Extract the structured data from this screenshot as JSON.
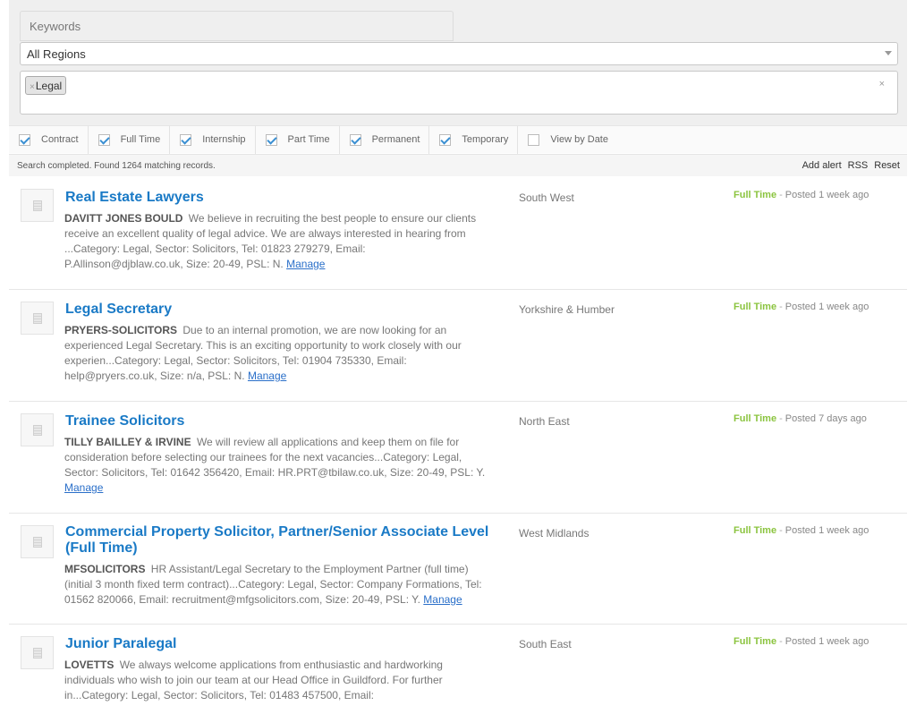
{
  "filters": {
    "keywords_placeholder": "Keywords",
    "region_selected": "All Regions",
    "tags": [
      {
        "remove_glyph": "×",
        "label": "Legal"
      }
    ],
    "clear_glyph": "×"
  },
  "job_types": [
    {
      "label": "Contract",
      "checked": true
    },
    {
      "label": "Full Time",
      "checked": true
    },
    {
      "label": "Internship",
      "checked": true
    },
    {
      "label": "Part Time",
      "checked": true
    },
    {
      "label": "Permanent",
      "checked": true
    },
    {
      "label": "Temporary",
      "checked": true
    },
    {
      "label": "View by Date",
      "checked": false
    }
  ],
  "status": {
    "message": "Search completed. Found 1264 matching records.",
    "actions": [
      "Add alert",
      "RSS",
      "Reset"
    ]
  },
  "jobs": [
    {
      "title_lines": [
        "Real Estate Lawyers"
      ],
      "company": "DAVITT JONES BOULD",
      "desc_lines": [
        "We believe in recruiting the best people to ensure our clients",
        "receive an excellent quality of legal advice. We are always interested in hearing from",
        "...Category: Legal, Sector: Solicitors, Tel: 01823 279279, Email:",
        "P.Allinson@djblaw.co.uk, Size: 20-49, PSL: N."
      ],
      "manage": "Manage",
      "location": "South West",
      "job_type": "Full Time",
      "separator": "-",
      "posted": "Posted 1 week ago"
    },
    {
      "title_lines": [
        "Legal Secretary"
      ],
      "company": "PRYERS-SOLICITORS",
      "desc_lines": [
        "Due to an internal promotion, we are now looking for an",
        "experienced Legal Secretary. This is an exciting opportunity to work closely with our",
        "experien...Category: Legal, Sector: Solicitors, Tel: 01904 735330, Email:",
        "help@pryers.co.uk, Size: n/a, PSL: N."
      ],
      "manage": "Manage",
      "location": "Yorkshire & Humber",
      "job_type": "Full Time",
      "separator": "-",
      "posted": "Posted 1 week ago"
    },
    {
      "title_lines": [
        "Trainee Solicitors"
      ],
      "company": "TILLY BAILLEY & IRVINE",
      "desc_lines": [
        "We will review all applications and keep them on file for",
        "consideration before selecting our trainees for the next vacancies...Category: Legal,",
        "Sector: Solicitors, Tel: 01642 356420, Email: HR.PRT@tbilaw.co.uk, Size: 20-49, PSL: Y.",
        ""
      ],
      "manage": "Manage",
      "location": "North East",
      "job_type": "Full Time",
      "separator": "-",
      "posted": "Posted 7 days ago"
    },
    {
      "title_lines": [
        "Commercial Property Solicitor, Partner/Senior Associate Level",
        "(Full Time)"
      ],
      "company": "MFSOLICITORS",
      "desc_lines": [
        "HR Assistant/Legal Secretary to the Employment Partner (full time)",
        "(initial 3 month fixed term contract)...Category: Legal, Sector: Company Formations, Tel:",
        "01562 820066, Email: recruitment@mfgsolicitors.com, Size: 20-49, PSL: Y."
      ],
      "manage": "Manage",
      "location": "West Midlands",
      "job_type": "Full Time",
      "separator": "-",
      "posted": "Posted 1 week ago"
    },
    {
      "title_lines": [
        "Junior Paralegal"
      ],
      "company": "LOVETTS",
      "desc_lines": [
        "We always welcome applications from enthusiastic and hardworking",
        "individuals who wish to join our team at our Head Office in Guildford. For further",
        "in...Category: Legal, Sector: Solicitors, Tel: 01483 457500, Email:"
      ],
      "manage": "",
      "location": "South East",
      "job_type": "Full Time",
      "separator": "-",
      "posted": "Posted 1 week ago"
    }
  ]
}
